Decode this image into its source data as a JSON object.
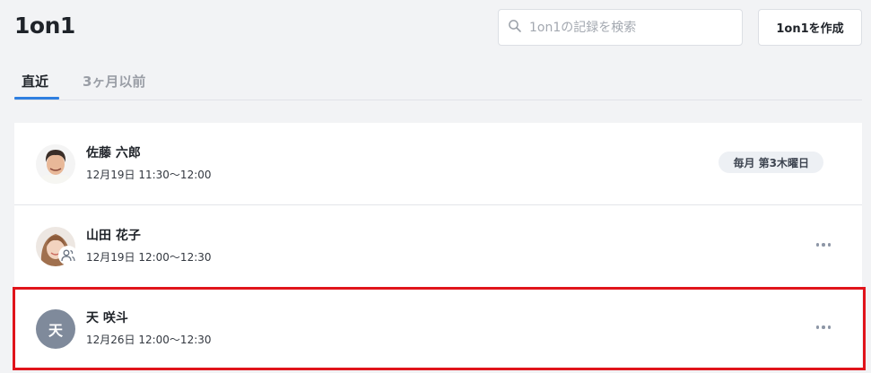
{
  "header": {
    "title": "1on1",
    "search": {
      "placeholder": "1on1の記録を検索",
      "value": ""
    },
    "create_button_label": "1on1を作成"
  },
  "tabs": [
    {
      "label": "直近",
      "active": true
    },
    {
      "label": "3ヶ月以前",
      "active": false
    }
  ],
  "meetings": [
    {
      "name": "佐藤 六郎",
      "datetime": "12月19日 11:30〜12:00",
      "recurrence": "毎月 第3木曜日",
      "avatar": "photo"
    },
    {
      "name": "山田 花子",
      "datetime": "12月19日 12:00〜12:30",
      "avatar": "photo",
      "group_icon": "group-icon",
      "menu_icon": "more-icon"
    },
    {
      "name": "天 咲斗",
      "datetime": "12月26日 12:00〜12:30",
      "avatar_initial": "天",
      "avatar_color": "#7f8a9b",
      "menu_icon": "more-icon",
      "highlighted": true
    }
  ],
  "colors": {
    "accent": "#2f7fe0",
    "highlight_border": "#e0141b",
    "background": "#f2f3f5"
  }
}
